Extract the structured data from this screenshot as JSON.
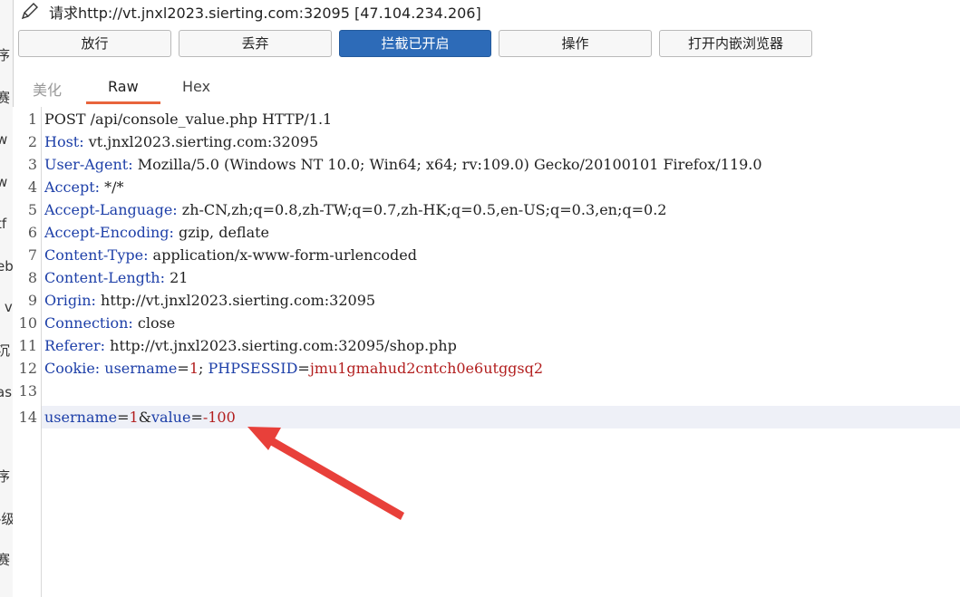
{
  "window": {
    "title": "请求http://vt.jnxl2023.sierting.com:32095  [47.104.234.206]"
  },
  "left_strip": [
    "序",
    "赛",
    "w",
    "w",
    "tf",
    "eb",
    "l v",
    "沉",
    "as",
    "序",
    "-级",
    "赛"
  ],
  "toolbar": {
    "forward": "放行",
    "drop": "丢弃",
    "intercept": "拦截已开启",
    "action": "操作",
    "open_browser": "打开内嵌浏览器",
    "accent_color": "#2d6bb8"
  },
  "tabs": {
    "pretty": "美化",
    "raw": "Raw",
    "hex": "Hex",
    "selected": "Raw"
  },
  "editor": {
    "line_numbers": [
      "1",
      "2",
      "3",
      "4",
      "5",
      "6",
      "7",
      "8",
      "9",
      "10",
      "11",
      "12",
      "13",
      "14"
    ],
    "line1": "POST /api/console_value.php HTTP/1.1",
    "headers": {
      "host_k": "Host",
      "host_v": " vt.jnxl2023.sierting.com:32095",
      "ua_k": "User-Agent",
      "ua_v": " Mozilla/5.0 (Windows NT 10.0; Win64; x64; rv:109.0) Gecko/20100101 Firefox/119.0",
      "accept_k": "Accept",
      "accept_v": " */*",
      "al_k": "Accept-Language",
      "al_v": " zh-CN,zh;q=0.8,zh-TW;q=0.7,zh-HK;q=0.5,en-US;q=0.3,en;q=0.2",
      "ae_k": "Accept-Encoding",
      "ae_v": " gzip, deflate",
      "ct_k": "Content-Type",
      "ct_v": " application/x-www-form-urlencoded",
      "cl_k": "Content-Length",
      "cl_v": " 21",
      "origin_k": "Origin",
      "origin_v": " http://vt.jnxl2023.sierting.com:32095",
      "conn_k": "Connection",
      "conn_v": " close",
      "ref_k": "Referer",
      "ref_v": " http://vt.jnxl2023.sierting.com:32095/shop.php",
      "cookie_k": "Cookie",
      "cookie_n1": "username",
      "cookie_v1": "1",
      "cookie_n2": "PHPSESSID",
      "cookie_v2": "jmu1gmahud2cntch0e6utggsq2"
    },
    "body": {
      "n1": "username",
      "v1": "1",
      "n2": "value",
      "v2": "-100"
    },
    "key_color": "#1d3fa8",
    "value_color": "#b21e1e"
  },
  "annotation": {
    "arrow_color": "#e8403a"
  }
}
